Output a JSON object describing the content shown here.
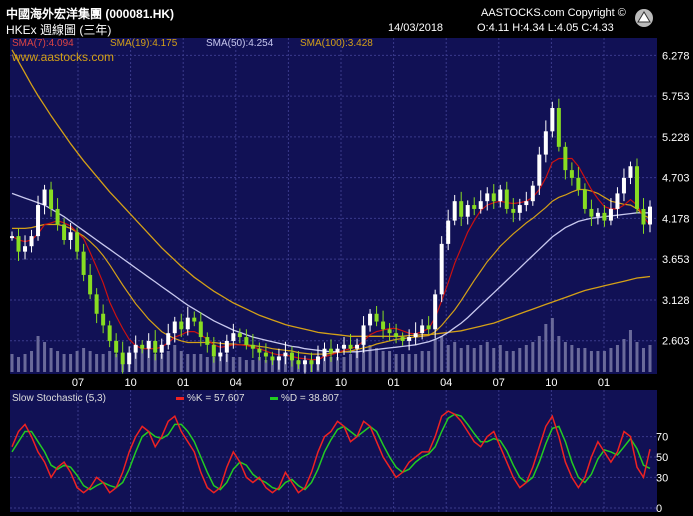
{
  "header": {
    "title": "中國海外宏洋集團 (000081.HK)",
    "subtitle": "HKEx 週線圖 (三年)",
    "copyright": "AASTOCKS.com Copyright ©",
    "date": "14/03/2018",
    "ohlc": "O:4.11 H:4.34 L:4.05 C:4.33"
  },
  "legend": {
    "sma7": "SMA(7):4.094",
    "sma19": "SMA(19):4.175",
    "sma50": "SMA(50):4.254",
    "sma100": "SMA(100):3.428",
    "watermark": "www.aastocks.com"
  },
  "stoch_legend": {
    "title": "Slow Stochastic (5,3)",
    "k": "%K = 57.607",
    "d": "%D = 38.807"
  },
  "colors": {
    "bg": "#000000",
    "panel": "#111155",
    "grid": "#3a3a8c",
    "candle_up": "#ffffff",
    "candle_down": "#88dd22",
    "sma7": "#cc1111",
    "sma19": "#d4a017",
    "sma50": "#c8c8ee",
    "sma100": "#d4a017",
    "stoch_k": "#ee2222",
    "stoch_d": "#22cc22"
  },
  "chart_data": {
    "type": "candlestick",
    "period": "weekly, three years",
    "x_tick_labels": [
      "07",
      "10",
      "01",
      "04",
      "07",
      "10",
      "01",
      "04",
      "07",
      "10",
      "01"
    ],
    "y_tick_labels": [
      "6.278",
      "5.753",
      "5.228",
      "4.703",
      "4.178",
      "3.653",
      "3.128",
      "2.603"
    ],
    "ylim": [
      2.2,
      6.45
    ],
    "close": [
      3.95,
      3.75,
      3.82,
      3.95,
      4.35,
      4.55,
      4.3,
      4.1,
      3.9,
      4.0,
      3.75,
      3.45,
      3.2,
      2.95,
      2.8,
      2.6,
      2.45,
      2.3,
      2.45,
      2.55,
      2.5,
      2.6,
      2.45,
      2.55,
      2.7,
      2.85,
      2.75,
      2.9,
      2.85,
      2.65,
      2.55,
      2.4,
      2.45,
      2.6,
      2.7,
      2.65,
      2.55,
      2.5,
      2.45,
      2.4,
      2.35,
      2.4,
      2.45,
      2.35,
      2.3,
      2.35,
      2.3,
      2.4,
      2.5,
      2.45,
      2.5,
      2.55,
      2.5,
      2.55,
      2.8,
      2.95,
      2.85,
      2.75,
      2.7,
      2.65,
      2.6,
      2.65,
      2.7,
      2.8,
      2.75,
      3.2,
      3.85,
      4.15,
      4.4,
      4.2,
      4.35,
      4.3,
      4.4,
      4.5,
      4.4,
      4.55,
      4.3,
      4.25,
      4.35,
      4.4,
      4.6,
      5.0,
      5.3,
      5.6,
      5.1,
      4.8,
      4.7,
      4.55,
      4.3,
      4.2,
      4.25,
      4.15,
      4.3,
      4.5,
      4.7,
      4.85,
      4.3,
      4.1,
      4.33
    ],
    "sma7": [
      3.95,
      3.9,
      3.88,
      3.9,
      3.98,
      4.1,
      4.12,
      4.15,
      4.12,
      4.08,
      4.0,
      3.92,
      3.74,
      3.55,
      3.35,
      3.1,
      2.92,
      2.76,
      2.62,
      2.54,
      2.5,
      2.5,
      2.5,
      2.52,
      2.58,
      2.65,
      2.68,
      2.72,
      2.72,
      2.68,
      2.62,
      2.55,
      2.52,
      2.53,
      2.55,
      2.55,
      2.54,
      2.52,
      2.5,
      2.47,
      2.44,
      2.42,
      2.42,
      2.4,
      2.38,
      2.37,
      2.36,
      2.36,
      2.4,
      2.42,
      2.45,
      2.48,
      2.5,
      2.53,
      2.6,
      2.68,
      2.72,
      2.74,
      2.76,
      2.76,
      2.73,
      2.7,
      2.69,
      2.72,
      2.76,
      2.9,
      3.12,
      3.35,
      3.6,
      3.8,
      4.0,
      4.15,
      4.28,
      4.35,
      4.38,
      4.4,
      4.38,
      4.37,
      4.38,
      4.4,
      4.45,
      4.55,
      4.7,
      4.9,
      4.95,
      4.95,
      4.95,
      4.85,
      4.7,
      4.55,
      4.43,
      4.33,
      4.3,
      4.3,
      4.35,
      4.42,
      4.35,
      4.2,
      4.09
    ],
    "sma19": [
      4.05,
      4.05,
      4.05,
      4.06,
      4.08,
      4.1,
      4.1,
      4.1,
      4.08,
      4.05,
      4.0,
      3.95,
      3.88,
      3.8,
      3.7,
      3.58,
      3.45,
      3.32,
      3.2,
      3.08,
      2.98,
      2.88,
      2.8,
      2.72,
      2.67,
      2.63,
      2.6,
      2.58,
      2.58,
      2.58,
      2.58,
      2.58,
      2.57,
      2.56,
      2.56,
      2.55,
      2.55,
      2.54,
      2.53,
      2.52,
      2.5,
      2.49,
      2.48,
      2.47,
      2.45,
      2.44,
      2.43,
      2.43,
      2.43,
      2.44,
      2.45,
      2.46,
      2.47,
      2.49,
      2.51,
      2.53,
      2.56,
      2.58,
      2.6,
      2.62,
      2.63,
      2.64,
      2.65,
      2.66,
      2.67,
      2.72,
      2.8,
      2.9,
      3.0,
      3.12,
      3.25,
      3.38,
      3.5,
      3.62,
      3.72,
      3.82,
      3.9,
      3.98,
      4.05,
      4.12,
      4.18,
      4.25,
      4.32,
      4.4,
      4.45,
      4.48,
      4.52,
      4.55,
      4.55,
      4.53,
      4.5,
      4.45,
      4.4,
      4.38,
      4.36,
      4.35,
      4.3,
      4.22,
      4.18
    ],
    "sma50": [
      4.5,
      4.47,
      4.44,
      4.41,
      4.38,
      4.35,
      4.3,
      4.25,
      4.2,
      4.14,
      4.08,
      4.02,
      3.96,
      3.9,
      3.84,
      3.78,
      3.72,
      3.66,
      3.6,
      3.54,
      3.48,
      3.42,
      3.36,
      3.3,
      3.24,
      3.18,
      3.12,
      3.06,
      3.01,
      2.96,
      2.91,
      2.86,
      2.82,
      2.78,
      2.74,
      2.71,
      2.68,
      2.65,
      2.63,
      2.61,
      2.59,
      2.57,
      2.55,
      2.53,
      2.52,
      2.5,
      2.49,
      2.48,
      2.47,
      2.46,
      2.46,
      2.46,
      2.46,
      2.46,
      2.47,
      2.48,
      2.49,
      2.5,
      2.51,
      2.52,
      2.53,
      2.54,
      2.55,
      2.57,
      2.59,
      2.62,
      2.66,
      2.71,
      2.77,
      2.83,
      2.9,
      2.98,
      3.06,
      3.14,
      3.22,
      3.3,
      3.38,
      3.46,
      3.54,
      3.62,
      3.7,
      3.78,
      3.86,
      3.94,
      4.0,
      4.06,
      4.1,
      4.14,
      4.16,
      4.18,
      4.19,
      4.2,
      4.21,
      4.22,
      4.23,
      4.24,
      4.25,
      4.25,
      4.25
    ],
    "sma100": [
      6.35,
      6.2,
      6.05,
      5.9,
      5.76,
      5.63,
      5.5,
      5.38,
      5.26,
      5.14,
      5.03,
      4.92,
      4.82,
      4.72,
      4.62,
      4.52,
      4.43,
      4.34,
      4.25,
      4.16,
      4.07,
      3.98,
      3.89,
      3.8,
      3.72,
      3.64,
      3.56,
      3.49,
      3.42,
      3.36,
      3.3,
      3.24,
      3.19,
      3.14,
      3.09,
      3.05,
      3.01,
      2.97,
      2.93,
      2.9,
      2.87,
      2.84,
      2.81,
      2.79,
      2.77,
      2.75,
      2.73,
      2.71,
      2.7,
      2.69,
      2.68,
      2.67,
      2.66,
      2.66,
      2.66,
      2.66,
      2.66,
      2.66,
      2.66,
      2.66,
      2.66,
      2.67,
      2.67,
      2.68,
      2.68,
      2.69,
      2.7,
      2.71,
      2.72,
      2.73,
      2.75,
      2.77,
      2.79,
      2.81,
      2.83,
      2.86,
      2.89,
      2.92,
      2.95,
      2.98,
      3.01,
      3.04,
      3.07,
      3.1,
      3.13,
      3.16,
      3.19,
      3.22,
      3.25,
      3.27,
      3.29,
      3.31,
      3.33,
      3.35,
      3.37,
      3.39,
      3.41,
      3.42,
      3.43
    ],
    "volume": [
      0.3,
      0.25,
      0.3,
      0.35,
      0.6,
      0.5,
      0.4,
      0.35,
      0.3,
      0.3,
      0.35,
      0.4,
      0.35,
      0.3,
      0.3,
      0.35,
      0.3,
      0.25,
      0.3,
      0.35,
      0.4,
      0.45,
      0.3,
      0.3,
      0.35,
      0.45,
      0.35,
      0.3,
      0.3,
      0.3,
      0.25,
      0.25,
      0.3,
      0.3,
      0.25,
      0.25,
      0.2,
      0.2,
      0.25,
      0.2,
      0.2,
      0.2,
      0.25,
      0.2,
      0.2,
      0.2,
      0.2,
      0.25,
      0.3,
      0.25,
      0.25,
      0.25,
      0.3,
      0.35,
      0.5,
      0.45,
      0.4,
      0.35,
      0.35,
      0.3,
      0.3,
      0.3,
      0.3,
      0.35,
      0.35,
      0.55,
      0.6,
      0.45,
      0.5,
      0.4,
      0.45,
      0.4,
      0.45,
      0.5,
      0.4,
      0.45,
      0.35,
      0.35,
      0.4,
      0.45,
      0.5,
      0.6,
      0.8,
      0.9,
      0.6,
      0.5,
      0.45,
      0.4,
      0.4,
      0.35,
      0.35,
      0.35,
      0.4,
      0.45,
      0.55,
      0.7,
      0.5,
      0.4,
      0.45
    ],
    "stochastic": {
      "y_tick_labels": [
        "70",
        "50",
        "30",
        "0"
      ],
      "ylim": [
        0,
        100
      ],
      "k": [
        60,
        75,
        82,
        70,
        55,
        45,
        30,
        40,
        45,
        35,
        20,
        15,
        20,
        30,
        25,
        15,
        20,
        35,
        55,
        70,
        80,
        75,
        60,
        70,
        85,
        90,
        75,
        65,
        55,
        35,
        20,
        15,
        20,
        40,
        55,
        45,
        30,
        25,
        30,
        20,
        15,
        20,
        35,
        25,
        15,
        20,
        35,
        55,
        70,
        75,
        85,
        80,
        65,
        70,
        85,
        80,
        65,
        50,
        40,
        30,
        35,
        45,
        50,
        55,
        55,
        70,
        90,
        95,
        92,
        85,
        75,
        65,
        60,
        70,
        75,
        60,
        45,
        30,
        20,
        25,
        40,
        60,
        80,
        90,
        70,
        45,
        30,
        20,
        30,
        50,
        65,
        55,
        45,
        55,
        75,
        70,
        40,
        30,
        57.607
      ],
      "d": [
        55,
        65,
        75,
        75,
        65,
        55,
        42,
        38,
        42,
        40,
        32,
        22,
        18,
        22,
        25,
        22,
        20,
        25,
        38,
        55,
        70,
        75,
        70,
        68,
        72,
        82,
        82,
        75,
        65,
        50,
        35,
        22,
        18,
        25,
        38,
        45,
        42,
        33,
        28,
        25,
        20,
        18,
        25,
        28,
        22,
        18,
        25,
        38,
        55,
        67,
        77,
        80,
        75,
        70,
        75,
        80,
        75,
        62,
        50,
        40,
        35,
        38,
        45,
        50,
        53,
        60,
        75,
        88,
        92,
        90,
        82,
        73,
        65,
        65,
        68,
        66,
        56,
        42,
        30,
        25,
        30,
        45,
        63,
        78,
        80,
        65,
        45,
        30,
        25,
        33,
        48,
        57,
        55,
        52,
        60,
        68,
        58,
        42,
        38.807
      ]
    }
  }
}
